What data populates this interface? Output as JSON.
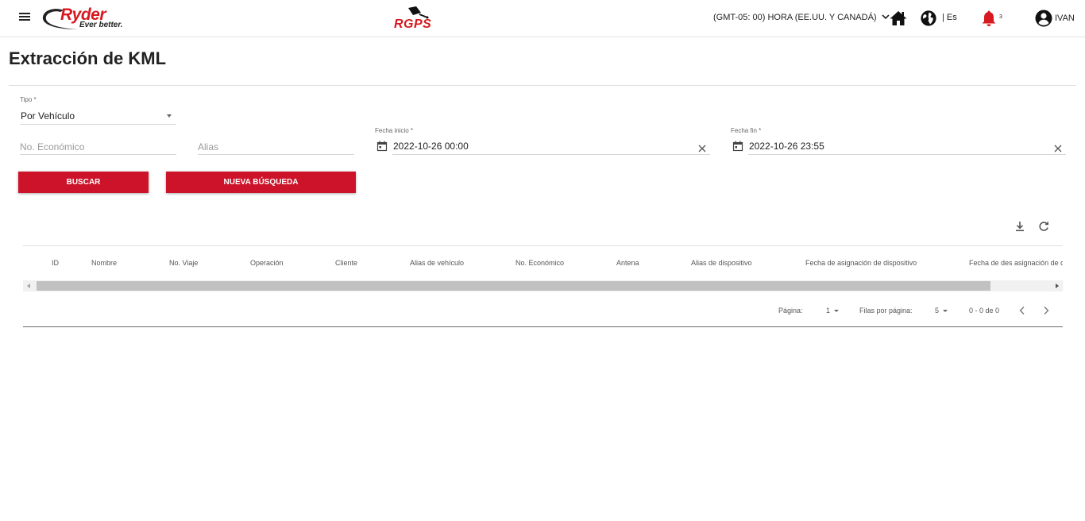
{
  "header": {
    "brand_name": "Ryder",
    "brand_tagline": "Ever better.",
    "product_name": "RGPS",
    "timezone": "(GMT-05: 00) HORA (EE.UU. Y CANADÁ)",
    "language": "| Es",
    "notification_count": "3",
    "user_name": "IVAN"
  },
  "page": {
    "title": "Extracción de KML"
  },
  "form": {
    "tipo_label": "Tipo *",
    "tipo_value": "Por Vehículo",
    "no_economico_placeholder": "No. Económico",
    "alias_placeholder": "Alias",
    "fecha_inicio_label": "Fecha inicio *",
    "fecha_inicio_value": "2022-10-26 00:00",
    "fecha_fin_label": "Fecha fin *",
    "fecha_fin_value": "2022-10-26 23:55",
    "buscar_label": "BUSCAR",
    "nueva_busqueda_label": "NUEVA BÚSQUEDA"
  },
  "table": {
    "columns": [
      "ID",
      "Nombre",
      "No. Viaje",
      "Operación",
      "Cliente",
      "Alias de vehículo",
      "No. Económico",
      "Antena",
      "Alias de dispositivo",
      "Fecha de asignación de dispositivo",
      "Fecha de des asignación de d"
    ]
  },
  "pagination": {
    "page_label": "Página:",
    "page_value": "1",
    "rows_label": "Filas por página:",
    "rows_value": "5",
    "range_text": "0 - 0 de 0"
  },
  "colors": {
    "brand_red": "#cc1329",
    "logo_red": "#d71920"
  },
  "icons": {
    "menu": "menu-icon",
    "home": "home-icon",
    "globe": "globe-icon",
    "bell": "bell-icon",
    "user": "account-circle-icon",
    "calendar": "calendar-icon",
    "clear": "close-icon",
    "download": "download-icon",
    "refresh": "refresh-icon"
  }
}
